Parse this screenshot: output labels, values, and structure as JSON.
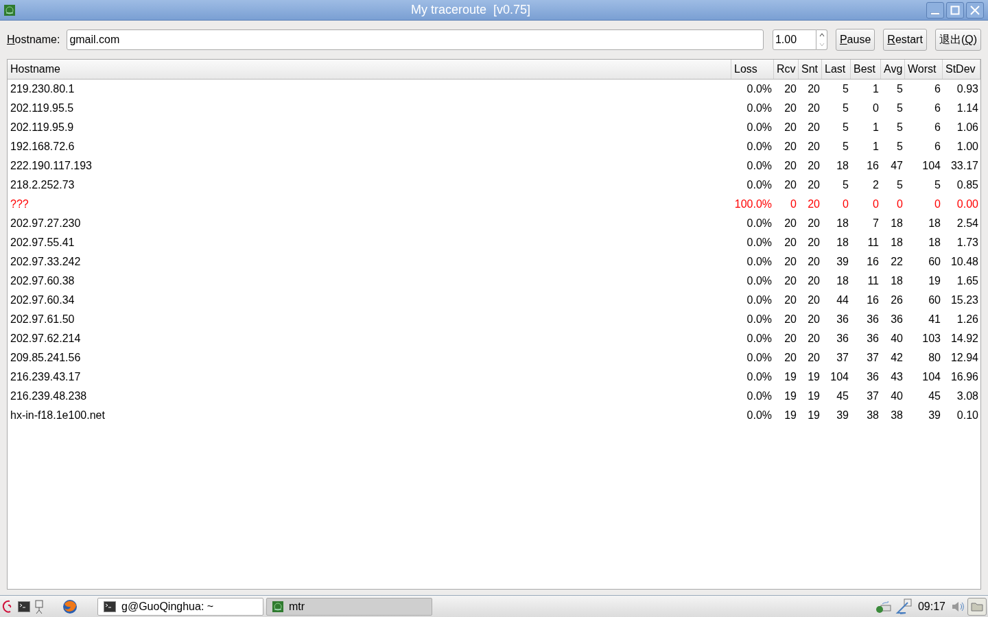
{
  "window": {
    "title": "My traceroute  [v0.75]"
  },
  "toolbar": {
    "hostname_label": {
      "mnemonic": "H",
      "after": "ostname:"
    },
    "hostname_value": "gmail.com",
    "interval_value": "1.00",
    "buttons": [
      {
        "mnemonic": "P",
        "after": "ause"
      },
      {
        "mnemonic": "R",
        "after": "estart"
      },
      {
        "before": "退出(",
        "mnemonic": "Q",
        "after": ")"
      }
    ]
  },
  "table": {
    "columns": [
      "Hostname",
      "Loss",
      "Rcv",
      "Snt",
      "Last",
      "Best",
      "Avg",
      "Worst",
      "StDev"
    ],
    "rows": [
      {
        "unreachable": false,
        "cells": [
          "219.230.80.1",
          "0.0%",
          "20",
          "20",
          "5",
          "1",
          "5",
          "6",
          "0.93"
        ]
      },
      {
        "unreachable": false,
        "cells": [
          "202.119.95.5",
          "0.0%",
          "20",
          "20",
          "5",
          "0",
          "5",
          "6",
          "1.14"
        ]
      },
      {
        "unreachable": false,
        "cells": [
          "202.119.95.9",
          "0.0%",
          "20",
          "20",
          "5",
          "1",
          "5",
          "6",
          "1.06"
        ]
      },
      {
        "unreachable": false,
        "cells": [
          "192.168.72.6",
          "0.0%",
          "20",
          "20",
          "5",
          "1",
          "5",
          "6",
          "1.00"
        ]
      },
      {
        "unreachable": false,
        "cells": [
          "222.190.117.193",
          "0.0%",
          "20",
          "20",
          "18",
          "16",
          "47",
          "104",
          "33.17"
        ]
      },
      {
        "unreachable": false,
        "cells": [
          "218.2.252.73",
          "0.0%",
          "20",
          "20",
          "5",
          "2",
          "5",
          "5",
          "0.85"
        ]
      },
      {
        "unreachable": true,
        "cells": [
          "???",
          "100.0%",
          "0",
          "20",
          "0",
          "0",
          "0",
          "0",
          "0.00"
        ]
      },
      {
        "unreachable": false,
        "cells": [
          "202.97.27.230",
          "0.0%",
          "20",
          "20",
          "18",
          "7",
          "18",
          "18",
          "2.54"
        ]
      },
      {
        "unreachable": false,
        "cells": [
          "202.97.55.41",
          "0.0%",
          "20",
          "20",
          "18",
          "11",
          "18",
          "18",
          "1.73"
        ]
      },
      {
        "unreachable": false,
        "cells": [
          "202.97.33.242",
          "0.0%",
          "20",
          "20",
          "39",
          "16",
          "22",
          "60",
          "10.48"
        ]
      },
      {
        "unreachable": false,
        "cells": [
          "202.97.60.38",
          "0.0%",
          "20",
          "20",
          "18",
          "11",
          "18",
          "19",
          "1.65"
        ]
      },
      {
        "unreachable": false,
        "cells": [
          "202.97.60.34",
          "0.0%",
          "20",
          "20",
          "44",
          "16",
          "26",
          "60",
          "15.23"
        ]
      },
      {
        "unreachable": false,
        "cells": [
          "202.97.61.50",
          "0.0%",
          "20",
          "20",
          "36",
          "36",
          "36",
          "41",
          "1.26"
        ]
      },
      {
        "unreachable": false,
        "cells": [
          "202.97.62.214",
          "0.0%",
          "20",
          "20",
          "36",
          "36",
          "40",
          "103",
          "14.92"
        ]
      },
      {
        "unreachable": false,
        "cells": [
          "209.85.241.56",
          "0.0%",
          "20",
          "20",
          "37",
          "37",
          "42",
          "80",
          "12.94"
        ]
      },
      {
        "unreachable": false,
        "cells": [
          "216.239.43.17",
          "0.0%",
          "19",
          "19",
          "104",
          "36",
          "43",
          "104",
          "16.96"
        ]
      },
      {
        "unreachable": false,
        "cells": [
          "216.239.48.238",
          "0.0%",
          "19",
          "19",
          "45",
          "37",
          "40",
          "45",
          "3.08"
        ]
      },
      {
        "unreachable": false,
        "cells": [
          "hx-in-f18.1e100.net",
          "0.0%",
          "19",
          "19",
          "39",
          "38",
          "38",
          "39",
          "0.10"
        ]
      }
    ]
  },
  "taskbar": {
    "tasks": [
      {
        "label": "g@GuoQinghua: ~",
        "kind": "terminal",
        "selected": false
      },
      {
        "label": "mtr",
        "kind": "mtr",
        "selected": true
      }
    ],
    "clock": "09:17"
  }
}
